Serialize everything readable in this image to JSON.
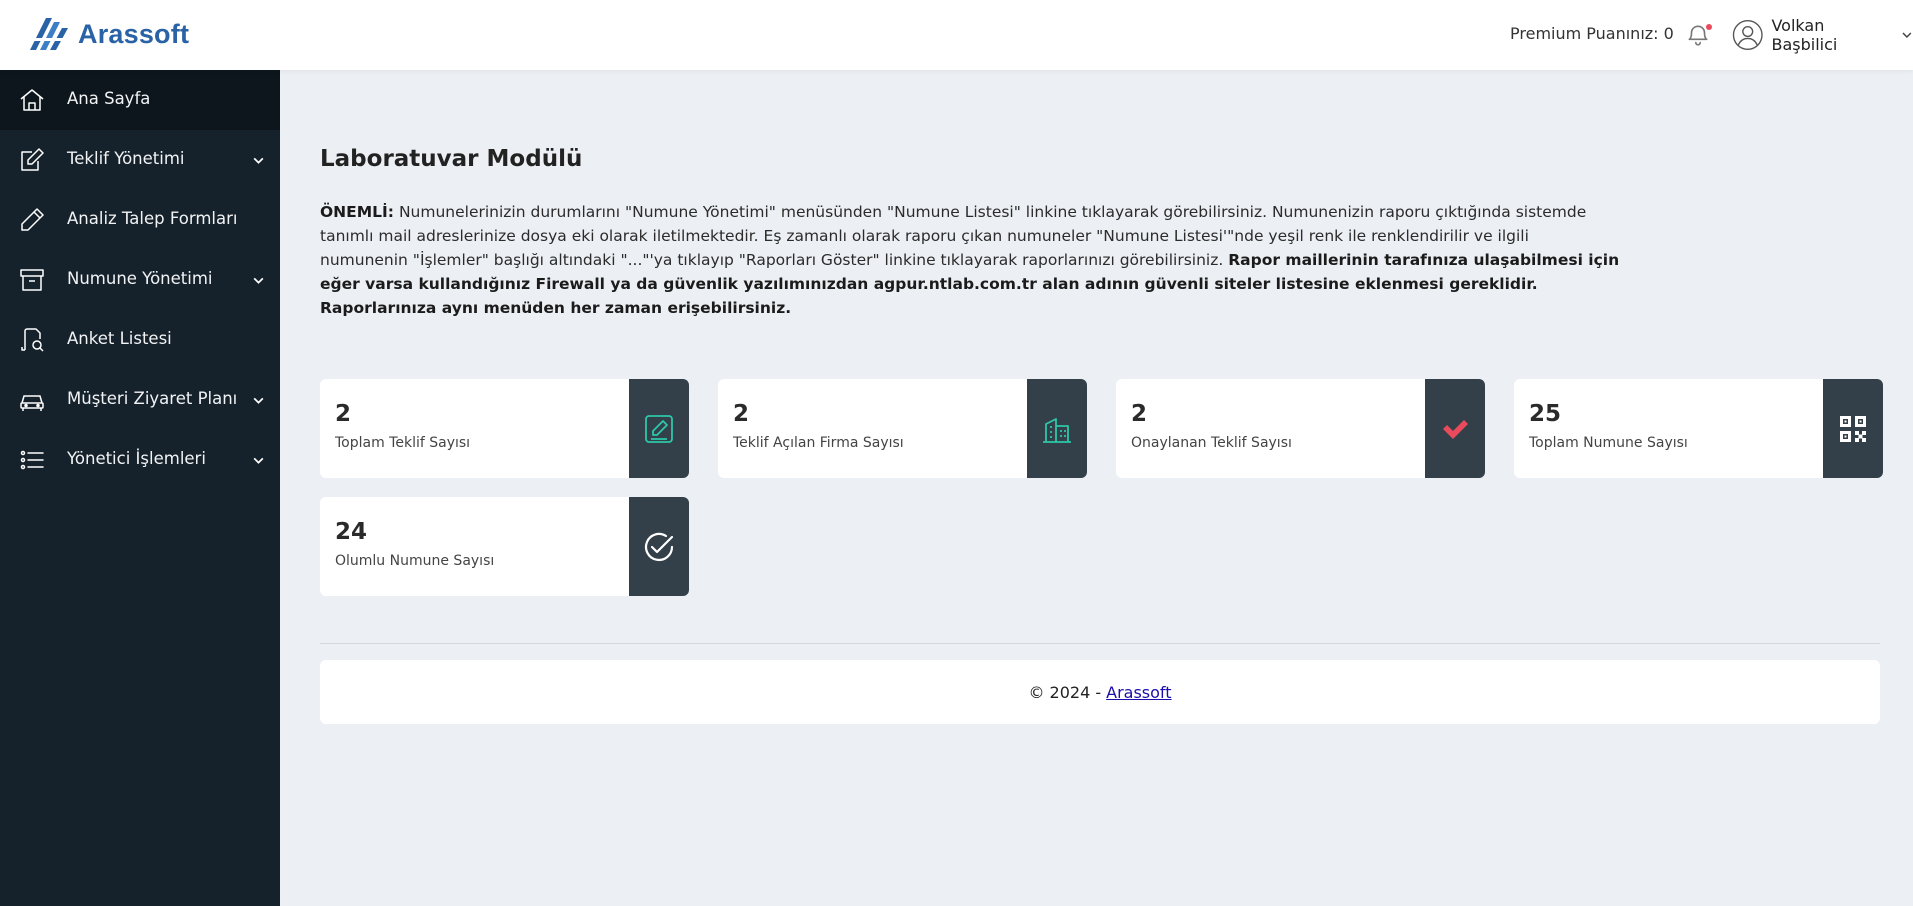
{
  "header": {
    "brand": "Arassoft",
    "premium_text": "Premium Puanınız: 0",
    "user_name": "Volkan Başbilici"
  },
  "sidebar": {
    "items": [
      {
        "label": "Ana Sayfa",
        "icon": "home-icon",
        "active": true,
        "has_submenu": false
      },
      {
        "label": "Teklif Yönetimi",
        "icon": "edit-document-icon",
        "active": false,
        "has_submenu": true
      },
      {
        "label": "Analiz Talep Formları",
        "icon": "pencil-icon",
        "active": false,
        "has_submenu": false
      },
      {
        "label": "Numune Yönetimi",
        "icon": "archive-box-icon",
        "active": false,
        "has_submenu": true
      },
      {
        "label": "Anket Listesi",
        "icon": "survey-document-icon",
        "active": false,
        "has_submenu": false
      },
      {
        "label": "Müşteri Ziyaret Planı",
        "icon": "car-icon",
        "active": false,
        "has_submenu": true
      },
      {
        "label": "Yönetici İşlemleri",
        "icon": "list-icon",
        "active": false,
        "has_submenu": true
      }
    ]
  },
  "main": {
    "title": "Laboratuvar Modülü",
    "notice_prefix": "ÖNEMLİ:",
    "notice_text": " Numunelerinizin durumlarını \"Numune Yönetimi\" menüsünden \"Numune Listesi\" linkine tıklayarak görebilirsiniz. Numunenizin raporu çıktığında sistemde tanımlı mail adreslerinize dosya eki olarak iletilmektedir. Eş zamanlı olarak raporu çıkan numuneler \"Numune Listesi'\"nde yeşil renk ile renklendirilir ve ilgili numunenin \"İşlemler\" başlığı altındaki \"...\"'ya tıklayıp \"Raporları Göster\" linkine tıklayarak raporlarınızı görebilirsiniz. ",
    "notice_bold": "Rapor maillerinin tarafınıza ulaşabilmesi için eğer varsa kullandığınız Firewall ya da güvenlik yazılımınızdan agpur.ntlab.com.tr alan adının güvenli siteler listesine eklenmesi gereklidir. Raporlarınıza aynı menüden her zaman erişebilirsiniz.",
    "cards": [
      {
        "value": "2",
        "label": "Toplam Teklif Sayısı",
        "icon": "edit-icon",
        "icon_color": "#2ec7a8"
      },
      {
        "value": "2",
        "label": "Teklif Açılan Firma Sayısı",
        "icon": "building-icon",
        "icon_color": "#2ec7a8"
      },
      {
        "value": "2",
        "label": "Onaylanan Teklif Sayısı",
        "icon": "check-icon",
        "icon_color": "#e94b5c"
      },
      {
        "value": "25",
        "label": "Toplam Numune Sayısı",
        "icon": "qr-code-icon",
        "icon_color": "#ffffff"
      },
      {
        "value": "24",
        "label": "Olumlu Numune Sayısı",
        "icon": "check-circle-icon",
        "icon_color": "#ffffff"
      }
    ]
  },
  "footer": {
    "copyright": "© 2024 -",
    "link_text": "Arassoft"
  },
  "colors": {
    "sidebar_bg": "#16222b",
    "sidebar_active_bg": "#0d161c",
    "brand_blue": "#2a62a6",
    "card_icon_bg": "#33404a",
    "page_bg": "#eceff3"
  }
}
